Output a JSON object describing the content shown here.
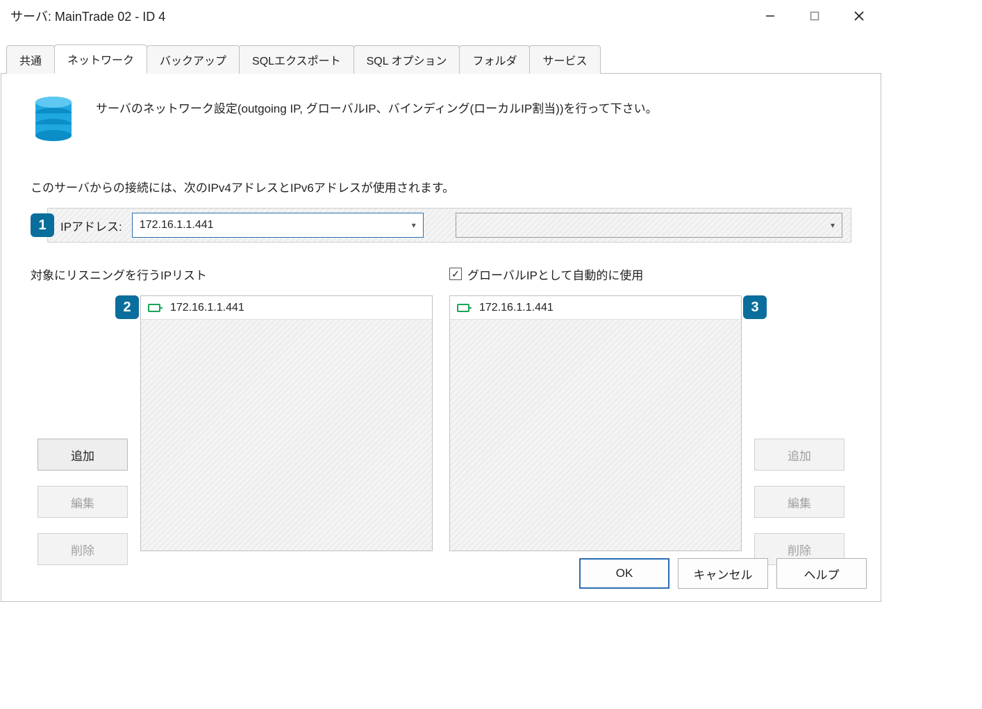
{
  "window_title": "サーバ: MainTrade 02 - ID 4",
  "tabs": [
    {
      "label": "共通"
    },
    {
      "label": "ネットワーク"
    },
    {
      "label": "バックアップ"
    },
    {
      "label": "SQLエクスポート"
    },
    {
      "label": "SQL オプション"
    },
    {
      "label": "フォルダ"
    },
    {
      "label": "サービス"
    }
  ],
  "active_tab_index": 1,
  "description": "サーバのネットワーク設定(outgoing IP, グローバルIP、バインディング(ローカルIP割当))を行って下さい。",
  "ip_section": {
    "intro": "このサーバからの接続には、次のIPv4アドレスとIPv6アドレスが使用されます。",
    "badge": "1",
    "label": "IPアドレス:",
    "ipv4_value": "172.16.1.1.441",
    "ipv6_value": ""
  },
  "left_list": {
    "title": "対象にリスニングを行うIPリスト",
    "badge": "2",
    "items": [
      "172.16.1.1.441"
    ],
    "buttons": {
      "add": "追加",
      "edit": "編集",
      "delete": "削除"
    }
  },
  "right_list": {
    "checkbox_label": "グローバルIPとして自動的に使用",
    "checked": true,
    "badge": "3",
    "items": [
      "172.16.1.1.441"
    ],
    "buttons": {
      "add": "追加",
      "edit": "編集",
      "delete": "削除"
    }
  },
  "footer": {
    "ok": "OK",
    "cancel": "キャンセル",
    "help": "ヘルプ"
  }
}
